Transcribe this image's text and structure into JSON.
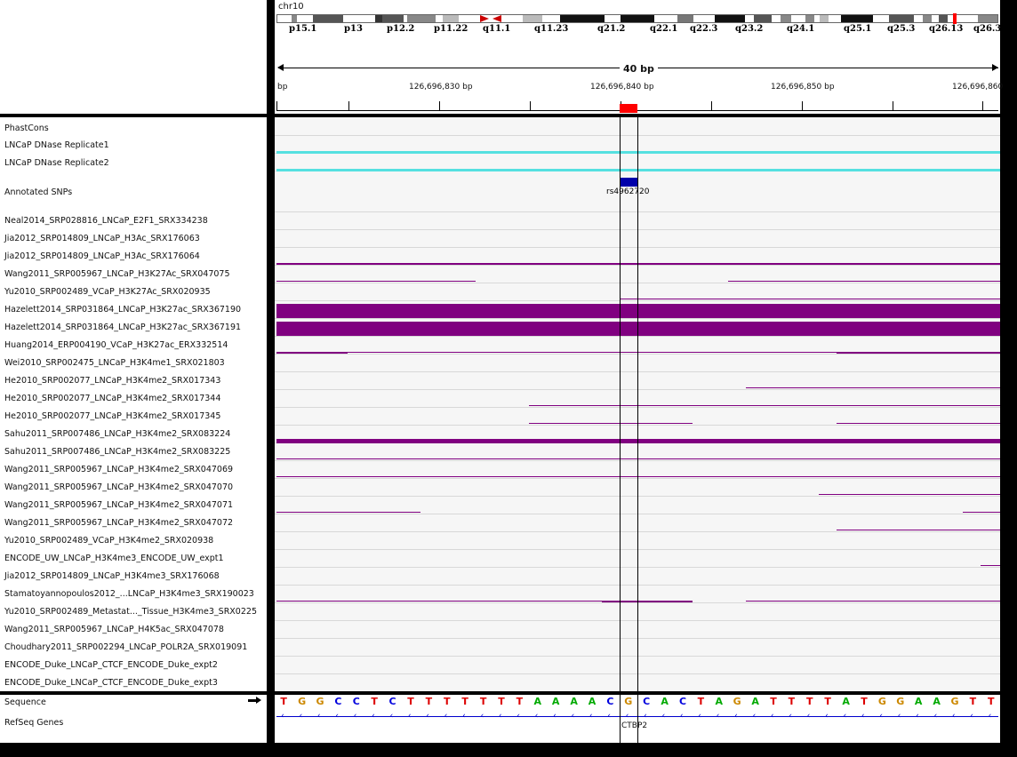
{
  "header": {
    "chrom": "chr10",
    "bands": [
      "p15.1",
      "p13",
      "p12.2",
      "p11.22",
      "q11.1",
      "q11.23",
      "q21.2",
      "q22.1",
      "q22.3",
      "q23.2",
      "q24.1",
      "q25.1",
      "q25.3",
      "q26.13",
      "q26.3"
    ],
    "span_label": "40 bp",
    "ruler": [
      "bp",
      "126,696,830 bp",
      "126,696,840 bp",
      "126,696,850 bp",
      "126,696,860"
    ]
  },
  "tracks": [
    {
      "name": "PhastCons"
    },
    {
      "name": "LNCaP DNase Replicate1"
    },
    {
      "name": "LNCaP DNase Replicate2"
    },
    {
      "name": "Annotated SNPs"
    },
    {
      "name": "Neal2014_SRP028816_LNCaP_E2F1_SRX334238"
    },
    {
      "name": "Jia2012_SRP014809_LNCaP_H3Ac_SRX176063"
    },
    {
      "name": "Jia2012_SRP014809_LNCaP_H3Ac_SRX176064"
    },
    {
      "name": "Wang2011_SRP005967_LNCaP_H3K27Ac_SRX047075"
    },
    {
      "name": "Yu2010_SRP002489_VCaP_H3K27Ac_SRX020935"
    },
    {
      "name": "Hazelett2014_SRP031864_LNCaP_H3K27ac_SRX367190"
    },
    {
      "name": "Hazelett2014_SRP031864_LNCaP_H3K27ac_SRX367191"
    },
    {
      "name": "Huang2014_ERP004190_VCaP_H3K27ac_ERX332514"
    },
    {
      "name": "Wei2010_SRP002475_LNCaP_H3K4me1_SRX021803"
    },
    {
      "name": "He2010_SRP002077_LNCaP_H3K4me2_SRX017343"
    },
    {
      "name": "He2010_SRP002077_LNCaP_H3K4me2_SRX017344"
    },
    {
      "name": "He2010_SRP002077_LNCaP_H3K4me2_SRX017345"
    },
    {
      "name": "Sahu2011_SRP007486_LNCaP_H3K4me2_SRX083224"
    },
    {
      "name": "Sahu2011_SRP007486_LNCaP_H3K4me2_SRX083225"
    },
    {
      "name": "Wang2011_SRP005967_LNCaP_H3K4me2_SRX047069"
    },
    {
      "name": "Wang2011_SRP005967_LNCaP_H3K4me2_SRX047070"
    },
    {
      "name": "Wang2011_SRP005967_LNCaP_H3K4me2_SRX047071"
    },
    {
      "name": "Wang2011_SRP005967_LNCaP_H3K4me2_SRX047072"
    },
    {
      "name": "Yu2010_SRP002489_VCaP_H3K4me2_SRX020938"
    },
    {
      "name": "ENCODE_UW_LNCaP_H3K4me3_ENCODE_UW_expt1"
    },
    {
      "name": "Jia2012_SRP014809_LNCaP_H3K4me3_SRX176068"
    },
    {
      "name": "Stamatoyannopoulos2012_...LNCaP_H3K4me3_SRX190023"
    },
    {
      "name": "Yu2010_SRP002489_Metastat..._Tissue_H3K4me3_SRX0225"
    },
    {
      "name": "Wang2011_SRP005967_LNCaP_H4K5ac_SRX047078"
    },
    {
      "name": "Choudhary2011_SRP002294_LNCaP_POLR2A_SRX019091"
    },
    {
      "name": "ENCODE_Duke_LNCaP_CTCF_ENCODE_Duke_expt2"
    },
    {
      "name": "ENCODE_Duke_LNCaP_CTCF_ENCODE_Duke_expt3"
    }
  ],
  "snp_label": "rs4962720",
  "sequence_label": "Sequence",
  "refseq_label": "RefSeq Genes",
  "sequence": "TGGCCTCTTTTTTTAAAACGCACTAGATTTTATGGAAGTT",
  "gene_label": "CTBP2",
  "colors": {
    "peak": "#800080",
    "dnase": "#55e0e0",
    "snp": "#0000aa",
    "A": "#00aa00",
    "C": "#0000dd",
    "G": "#cc8800",
    "T": "#dd0000"
  }
}
